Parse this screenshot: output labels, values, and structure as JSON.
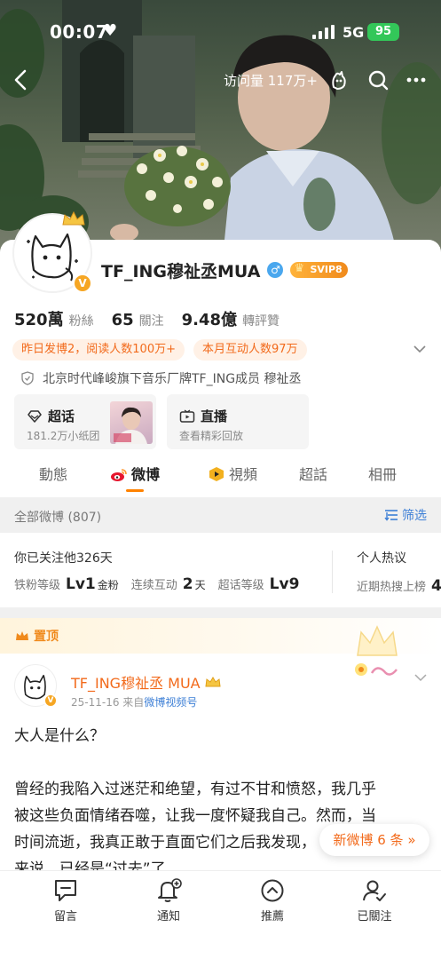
{
  "status": {
    "time": "00:07",
    "network": "5G",
    "battery": "95"
  },
  "nav": {
    "visits": "访问量 117万+"
  },
  "profile": {
    "name": "TF_ING穆祉丞MUA",
    "svip": "SVIP8",
    "stats": [
      {
        "num": "520萬",
        "label": "粉絲"
      },
      {
        "num": "65",
        "label": "關注"
      },
      {
        "num": "9.48億",
        "label": "轉評贊"
      }
    ],
    "chips": [
      "昨日发博2，阅读人数100万+",
      "本月互动人数97万"
    ],
    "verify": "北京时代峰峻旗下音乐厂牌TF_ING成员 穆祉丞",
    "tiles": [
      {
        "title": "超话",
        "sub": "181.2万小纸团"
      },
      {
        "title": "直播",
        "sub": "查看精彩回放"
      }
    ]
  },
  "tabs": [
    "動態",
    "微博",
    "視頻",
    "超話",
    "相冊"
  ],
  "filter": {
    "label": "全部微博 (807)",
    "button": "筛选"
  },
  "fan": {
    "head": "你已关注他326天",
    "stats": [
      {
        "label": "铁粉等级",
        "value": "Lv1",
        "unit": "金粉"
      },
      {
        "label": "连续互动",
        "value": "2",
        "unit": "天"
      },
      {
        "label": "超话等级",
        "value": "Lv9",
        "unit": ""
      }
    ],
    "hot_title": "个人热议",
    "hot_label": "近期热搜上榜",
    "hot_value": "4"
  },
  "post": {
    "pin": "置顶",
    "author": "TF_ING穆祉丞 MUA",
    "date": "25-11-16",
    "from_prefix": "来自",
    "source": "微博视频号",
    "lines": [
      "大人是什么？",
      "",
      "曾经的我陷入过迷茫和绝望，有过不甘和愤怒，我几乎",
      "被这些负面情绪吞噬，让我一度怀疑我自己。然而，当",
      "时间流逝，我真正敢于直面它们之后我发现，",
      "来说，已经是“过去”了。"
    ]
  },
  "new_posts": "新微博 6 条",
  "bottom_nav": [
    "留言",
    "通知",
    "推薦",
    "已關注"
  ]
}
